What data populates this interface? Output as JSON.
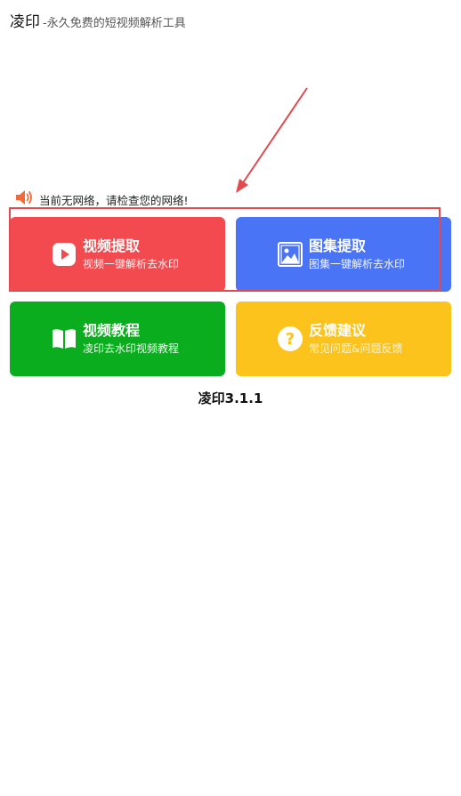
{
  "header": {
    "app_name": "凌印",
    "subtitle": "-永久免费的短视频解析工具"
  },
  "notice": {
    "icon": "speaker-icon",
    "text": "当前无网络，请检查您的网络!"
  },
  "cards": {
    "video": {
      "icon": "play-icon",
      "title": "视频提取",
      "desc": "视频一键解析去水印",
      "color": "#f34a4f"
    },
    "gallery": {
      "icon": "image-icon",
      "title": "图集提取",
      "desc": "图集一键解析去水印",
      "color": "#4a74f6"
    },
    "tutorial": {
      "icon": "book-icon",
      "title": "视频教程",
      "desc": "凌印去水印视频教程",
      "color": "#0aad1d"
    },
    "feedback": {
      "icon": "question-icon",
      "title": "反馈建议",
      "desc": "常见问题&问题反馈",
      "color": "#fbc31b"
    }
  },
  "version": "凌印3.1.1",
  "annotation_color": "#e14a4f"
}
